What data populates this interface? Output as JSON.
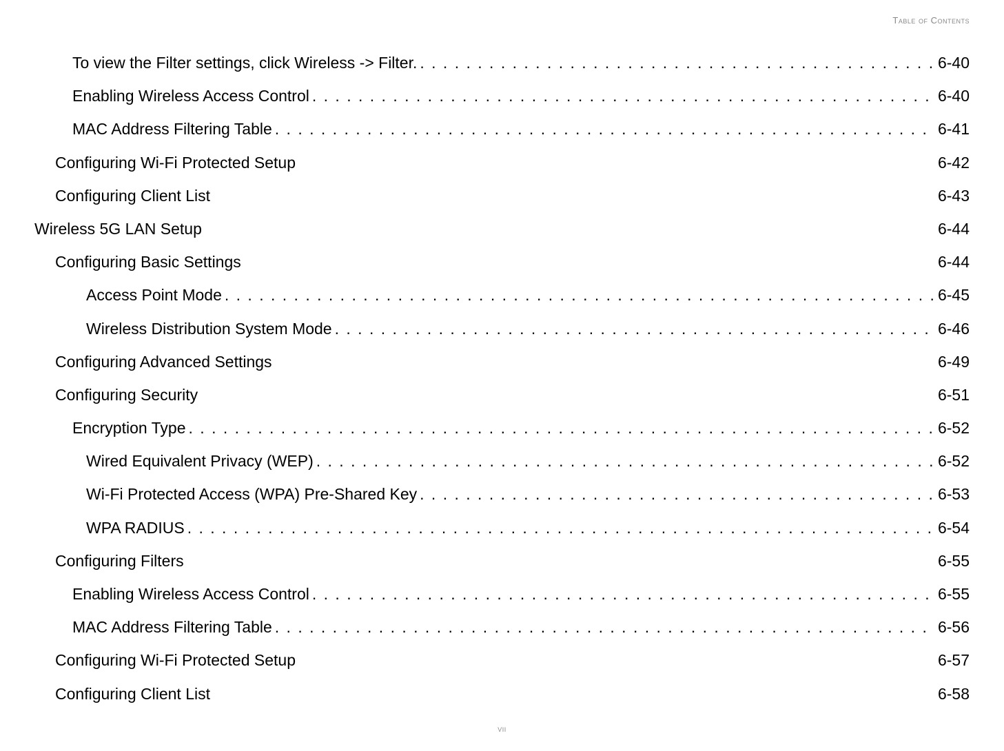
{
  "header": "Table of Contents",
  "footer": "vii",
  "entries": [
    {
      "title": "To view the Filter settings, click Wireless -> Filter.",
      "page": "6-40",
      "indent": 2,
      "dotted": true
    },
    {
      "title": "Enabling Wireless Access Control",
      "page": "6-40",
      "indent": 2,
      "dotted": true
    },
    {
      "title": "MAC Address Filtering Table",
      "page": "6-41",
      "indent": 2,
      "dotted": true
    },
    {
      "title": "Configuring Wi-Fi Protected Setup",
      "page": "6-42",
      "indent": 1,
      "dotted": false
    },
    {
      "title": "Configuring Client List",
      "page": "6-43",
      "indent": 1,
      "dotted": false
    },
    {
      "title": "Wireless 5G LAN Setup",
      "page": "6-44",
      "indent": 0,
      "dotted": false
    },
    {
      "title": "Configuring Basic Settings",
      "page": "6-44",
      "indent": 1,
      "dotted": false
    },
    {
      "title": "Access Point Mode",
      "page": "6-45",
      "indent": 3,
      "dotted": true
    },
    {
      "title": "Wireless Distribution System Mode",
      "page": "6-46",
      "indent": 3,
      "dotted": true
    },
    {
      "title": "Configuring Advanced Settings",
      "page": "6-49",
      "indent": 1,
      "dotted": false
    },
    {
      "title": "Configuring Security",
      "page": "6-51",
      "indent": 1,
      "dotted": false
    },
    {
      "title": "Encryption Type",
      "page": "6-52",
      "indent": 2,
      "dotted": true
    },
    {
      "title": "Wired Equivalent Privacy (WEP)",
      "page": "6-52",
      "indent": 3,
      "dotted": true
    },
    {
      "title": "Wi-Fi Protected Access (WPA) Pre-Shared Key",
      "page": "6-53",
      "indent": 3,
      "dotted": true
    },
    {
      "title": "WPA RADIUS",
      "page": "6-54",
      "indent": 3,
      "dotted": true
    },
    {
      "title": "Configuring Filters",
      "page": "6-55",
      "indent": 1,
      "dotted": false
    },
    {
      "title": "Enabling Wireless Access Control",
      "page": "6-55",
      "indent": 2,
      "dotted": true
    },
    {
      "title": "MAC Address Filtering Table",
      "page": "6-56",
      "indent": 2,
      "dotted": true
    },
    {
      "title": "Configuring Wi-Fi Protected Setup",
      "page": "6-57",
      "indent": 1,
      "dotted": false
    },
    {
      "title": "Configuring Client List",
      "page": "6-58",
      "indent": 1,
      "dotted": false
    }
  ]
}
